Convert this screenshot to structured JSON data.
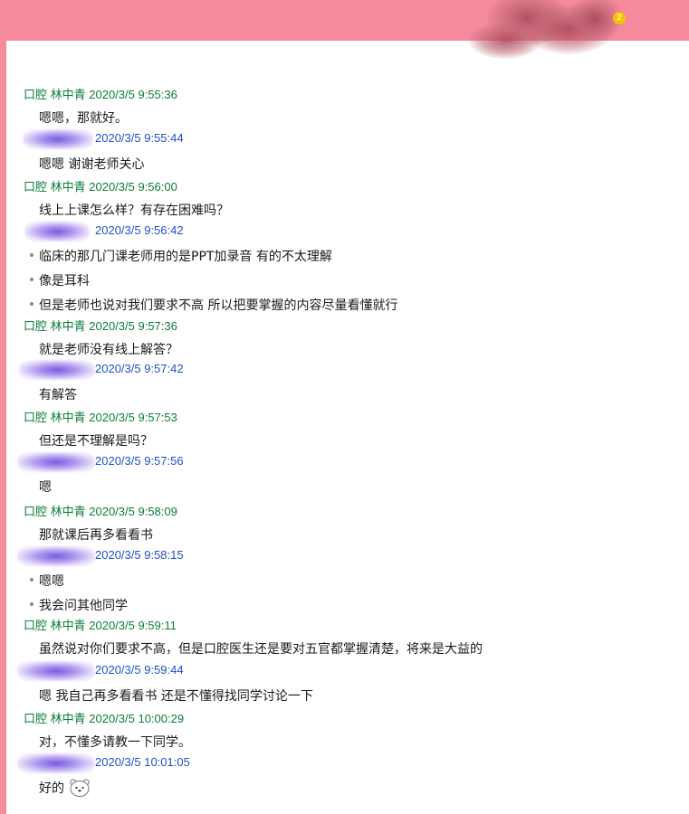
{
  "window": {
    "badge": "2",
    "colors": {
      "frame": "#f58a9c",
      "teacher_name": "#0b7d3a",
      "student_name": "#2050c8",
      "text": "#1a1a1a"
    }
  },
  "messages": [
    {
      "sender": "口腔 林中青",
      "time": "2020/3/5 9:55:36",
      "role": "teacher",
      "lines": [
        {
          "text": "嗯嗯，那就好。",
          "bullet": false
        }
      ]
    },
    {
      "sender": "",
      "time": "2020/3/5 9:55:44",
      "role": "student",
      "lines": [
        {
          "text": "嗯嗯 谢谢老师关心",
          "bullet": false
        }
      ]
    },
    {
      "sender": "口腔 林中青",
      "time": "2020/3/5 9:56:00",
      "role": "teacher",
      "lines": [
        {
          "text": "线上上课怎么样？有存在困难吗？",
          "bullet": false
        }
      ]
    },
    {
      "sender": "",
      "time": "2020/3/5 9:56:42",
      "role": "student",
      "lines": [
        {
          "text": "临床的那几门课老师用的是PPT加录音 有的不太理解",
          "bullet": true
        },
        {
          "text": "像是耳科",
          "bullet": true
        },
        {
          "text": "但是老师也说对我们要求不高 所以把要掌握的内容尽量看懂就行",
          "bullet": true
        }
      ]
    },
    {
      "sender": "口腔 林中青",
      "time": "2020/3/5 9:57:36",
      "role": "teacher",
      "lines": [
        {
          "text": "就是老师没有线上解答？",
          "bullet": false
        }
      ]
    },
    {
      "sender": "",
      "time": "2020/3/5 9:57:42",
      "role": "student",
      "lines": [
        {
          "text": "有解答",
          "bullet": false
        }
      ]
    },
    {
      "sender": "口腔 林中青",
      "time": "2020/3/5 9:57:53",
      "role": "teacher",
      "lines": [
        {
          "text": "但还是不理解是吗？",
          "bullet": false
        }
      ]
    },
    {
      "sender": "",
      "time": "2020/3/5 9:57:56",
      "role": "student",
      "lines": [
        {
          "text": "嗯",
          "bullet": false
        }
      ]
    },
    {
      "sender": "口腔 林中青",
      "time": "2020/3/5 9:58:09",
      "role": "teacher",
      "lines": [
        {
          "text": "那就课后再多看看书",
          "bullet": false
        }
      ]
    },
    {
      "sender": "",
      "time": "2020/3/5 9:58:15",
      "role": "student",
      "lines": [
        {
          "text": "嗯嗯",
          "bullet": true
        },
        {
          "text": "我会问其他同学",
          "bullet": true
        }
      ]
    },
    {
      "sender": "口腔 林中青",
      "time": "2020/3/5 9:59:11",
      "role": "teacher",
      "lines": [
        {
          "text": "虽然说对你们要求不高，但是口腔医生还是要对五官都掌握清楚，将来是大益的",
          "bullet": false
        }
      ]
    },
    {
      "sender": "",
      "time": "2020/3/5 9:59:44",
      "role": "student",
      "lines": [
        {
          "text": "嗯 我自己再多看看书 还是不懂得找同学讨论一下",
          "bullet": false
        }
      ]
    },
    {
      "sender": "口腔 林中青",
      "time": "2020/3/5 10:00:29",
      "role": "teacher",
      "lines": [
        {
          "text": "对，不懂多请教一下同学。",
          "bullet": false
        }
      ]
    },
    {
      "sender": "",
      "time": "2020/3/5 10:01:05",
      "role": "student",
      "lines": [
        {
          "text": "好的",
          "bullet": false,
          "emoji": "bear-icon"
        }
      ]
    }
  ]
}
